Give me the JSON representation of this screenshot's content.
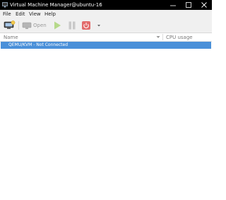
{
  "window": {
    "title": "Virtual Machine Manager@ubuntu-16",
    "icon": "monitor-icon",
    "controls": [
      "minimize-icon",
      "maximize-icon",
      "close-icon"
    ]
  },
  "menubar": {
    "items": [
      "File",
      "Edit",
      "View",
      "Help"
    ]
  },
  "toolbar": {
    "new_vm_icon": "new-vm-icon",
    "open_label": "Open",
    "open_icon": "monitor-open-icon",
    "run_icon": "play-icon",
    "pause_icon": "pause-icon",
    "shutdown_icon": "power-icon",
    "shutdown_menu_icon": "chevron-down-icon",
    "colors": {
      "run": "#b6d98a",
      "pause": "#c9c9c9",
      "shutdown": "#e26b6b"
    }
  },
  "list": {
    "columns": {
      "name": "Name",
      "cpu": "CPU usage"
    },
    "rows": [
      {
        "label": "QEMU/KVM - Not Connected",
        "selected": true
      }
    ],
    "selection_color": "#4a90d9"
  }
}
